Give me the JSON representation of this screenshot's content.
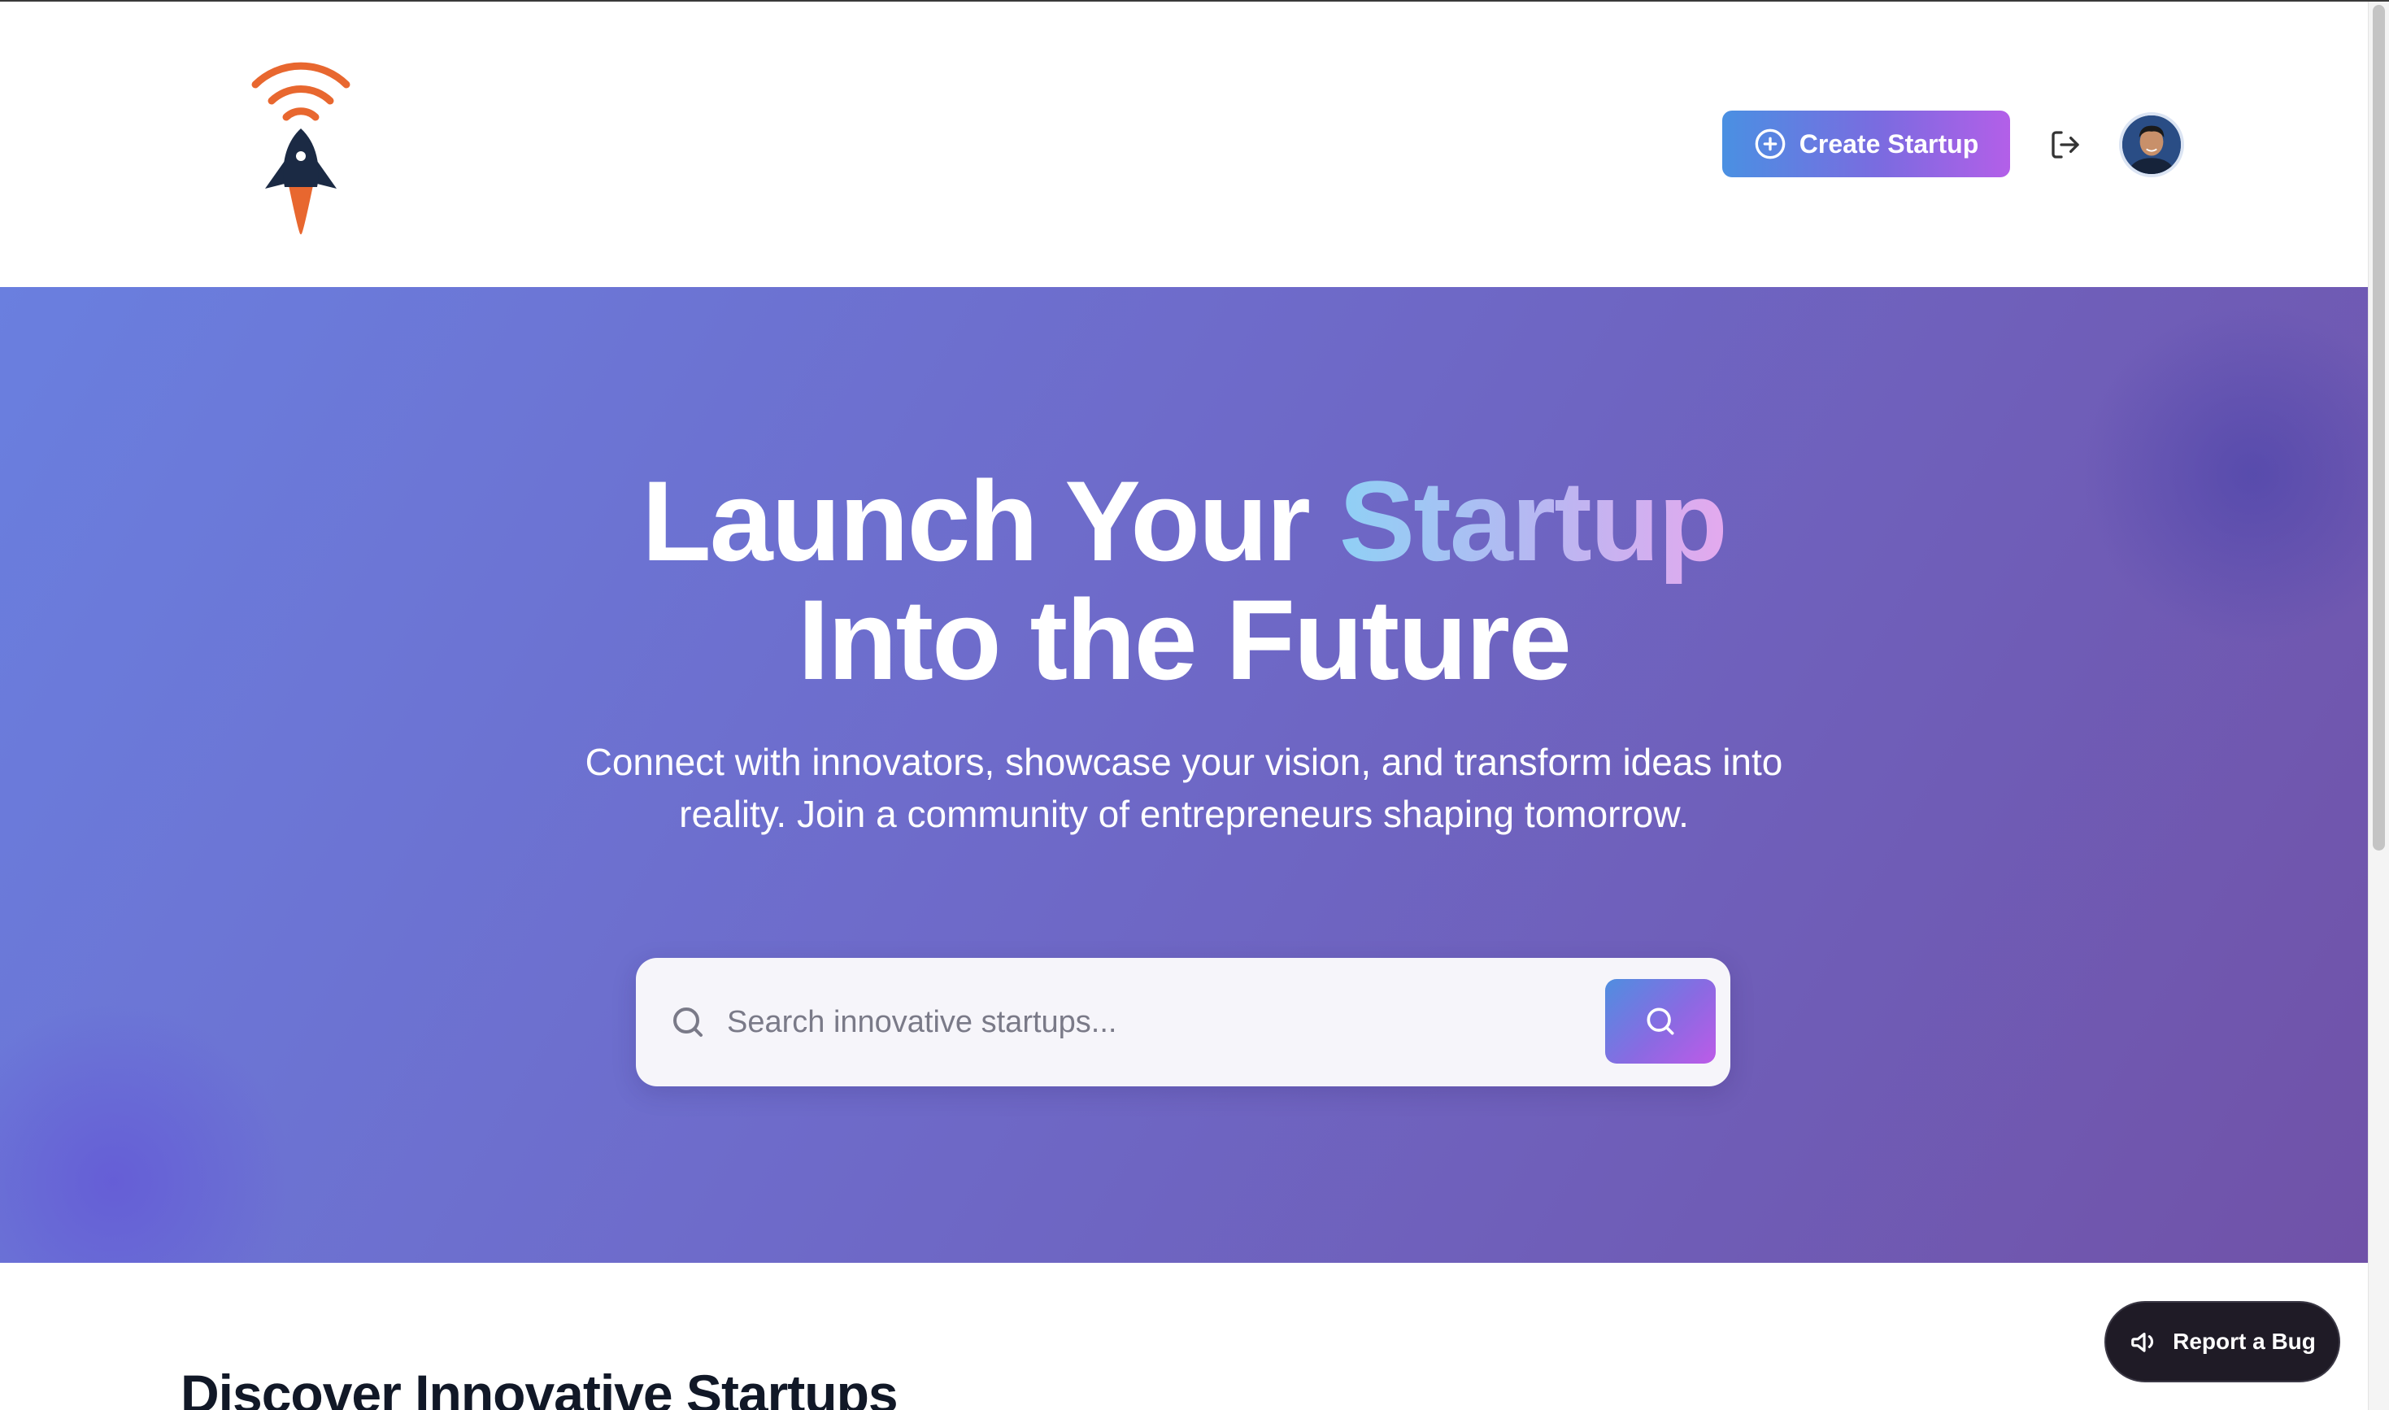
{
  "header": {
    "logo_name": "rocket-signal-logo",
    "create_label": "Create Startup",
    "icons": {
      "create": "plus-circle-icon",
      "logout": "logout-icon"
    }
  },
  "hero": {
    "title_line1_a": "Launch Your ",
    "title_line1_b": "Startup",
    "title_line2": "Into the Future",
    "subtitle": "Connect with innovators, showcase your vision, and transform ideas into reality. Join a community of entrepreneurs shaping tomorrow.",
    "search": {
      "placeholder": "Search innovative startups...",
      "value": ""
    }
  },
  "section": {
    "title": "Discover Innovative Startups"
  },
  "floating": {
    "report_label": "Report a Bug",
    "icon": "megaphone-icon"
  },
  "colors": {
    "accent_start": "#4a90e2",
    "accent_end": "#b35fe8",
    "hero_start": "#6a7fdf",
    "hero_end": "#7052a8",
    "logo_orange": "#e8672f",
    "logo_navy": "#1b2a44"
  }
}
